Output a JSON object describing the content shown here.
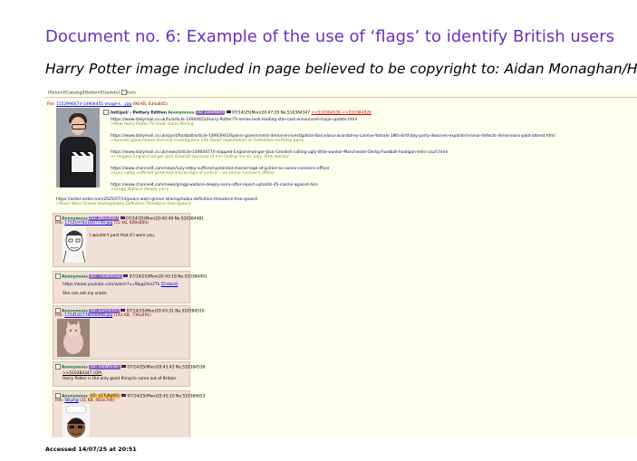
{
  "document": {
    "title": "Document no. 6: Example of the use of ‘flags’ to identify British users",
    "subtitle": "Harry Potter image included in page believed to be copyright to: Aidan Monaghan/HBO",
    "accessed": "Accessed 14/07/25 at 20:51"
  },
  "screenshot": {
    "nav": [
      "[Return]",
      "[Catalog]",
      "[Bottom]",
      "[Update]",
      "Auto"
    ],
    "op": {
      "file_label": "File:",
      "file_link": "1552996673-14904451-image-t....jpg",
      "file_meta": "(98 KB, 634x845)",
      "subject": "/intl/pol/ - Pottery Edition",
      "name": "Anonymous",
      "id": "(ID: pokeN0A)",
      "datetime": "07/14/25(Mon)20:47:29",
      "no": "No.510384347",
      "replies": ">>510384538 >>510384826",
      "items": [
        {
          "url": "https://www.dailymail.co.uk/tv/article-14904451/Harry-Potter-TV-series-look-leading-star-cast-announced-major-update.html",
          "quote": ">New Harry Potter TV show starts filming"
        },
        {
          "url": "https://www.dailymail.co.uk/sport/football/article-14903943/Spains-government-demand-investigation-Barcelona-acordotrey-Lamine-Yamals-18th-birthday-party-dwarves-exploited-minor-defects-dimensions-paid-attend.html",
          "quote": ">Spanish government demand investigation into Dwarf exploitation at footballers birthday party"
        },
        {
          "url": "https://www.dailymail.co.uk/news/article-14904477/I-slapped-England-winger-Jack-Grealish-calling-ugly-little-wanker-Manchester-Derby-Football-hooligan-tells-court.html",
          "quote": ">I slapped England winger Jack Grealish because of him calling me an 'ugly, little wanker'"
        },
        {
          "url": "https://www.channel4.com/news/lucy-letby-suffered-potential-miscarriage-of-justice-ex-senior-coroners-officer",
          "quote": ">Lucy Letby suffered 'potential miscarriage of justice' – ex-senior coroner's officer"
        },
        {
          "url": "https://www.channel4.com/news/gregg-wallace-deeply-sorry-after-report-upholds-45-claims-against-him",
          "quote": ">Gregg Wallace deeply sorry"
        }
      ],
      "extra_url": "https://order-order.com/2025/07/14/pears-warn-grieve-islamophobia-definition-threatens-free-speech",
      "extra_quote": ">Pears Warn Grieve Islamophobia Definition Threatens Free Speech"
    },
    "replies": [
      {
        "name": "Anonymous",
        "id": "(ID: JWin20wi)",
        "datetime": "07/14/25(Mon)20:42:49",
        "no": "No.510384481",
        "file_label": "File:",
        "file_link": "1752197821607749.jpg",
        "file_meta": "(72 KB, 600x800)",
        "text": "I wouldn't post that if I were you."
      },
      {
        "name": "Anonymous",
        "id": "(ID: 7xGBnlhsq)",
        "datetime": "07/14/25(Mon)20:43:18",
        "no": "No.510384491",
        "url": "https://www.youtube.com/watch?v=f8pg2Xvi2Tk",
        "embed": "[Embed]",
        "text": "She can eat my snake"
      },
      {
        "name": "Anonymous",
        "id": "(ID: p1m4ch1)",
        "datetime": "07/14/25(Mon)20:43:31",
        "no": "No.510384516",
        "file_label": "File:",
        "file_link": "1754102778000998.jpg",
        "file_meta": "(142 KB, 736x491)"
      },
      {
        "name": "Anonymous",
        "id": "(ID: mkWrU3k)",
        "datetime": "07/14/25(Mon)20:43:42",
        "no": "No.510384538",
        "quotelink": ">>510384347 (OP)",
        "text": "Harry Potter is the only good thing to come out of Britain"
      },
      {
        "name": "Anonymous",
        "id": "(ID: a1Tu8p60)",
        "datetime": "07/14/25(Mon)20:45:10",
        "no": "No.510384653",
        "file_label": "File:",
        "file_link": "58.png",
        "file_meta": "(31 KB, 483x746)"
      }
    ]
  }
}
